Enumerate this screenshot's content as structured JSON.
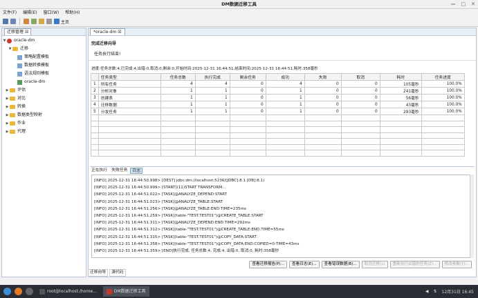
{
  "window": {
    "title": "DM数据迁移工具",
    "controls": [
      "—",
      "□",
      "✕"
    ]
  },
  "menu": [
    "文件(F)",
    "编辑(E)",
    "窗口(W)",
    "帮助(H)"
  ],
  "toolbar": {
    "home_label": "主页"
  },
  "left_panel": {
    "tab_label": "迁移管理 ☒",
    "tree": {
      "root": "oracle-dm",
      "migration": "迁移",
      "children": [
        "策略配置模板",
        "数据转换模板",
        "语法规则模板",
        "oracle-dm"
      ],
      "others": [
        "评估",
        "对比",
        "转换",
        "数据类型映射",
        "作业",
        "代理"
      ]
    }
  },
  "editor": {
    "tab_label": "*oracle-dm ☒",
    "wizard_title": "完成迁移向导",
    "wizard_msg": "任务执行结束!",
    "summary": "进度:任务总数:4,已完成:4,出错:0,取消:0,剩余:0,开始时间:2025-12-31 16:44:51,结束时间:2025-12-31 16:44:51,耗时:358毫秒",
    "table": {
      "headers": [
        "任务类型",
        "任务总数",
        "执行完成",
        "剩余任务",
        "成功",
        "失败",
        "取消",
        "耗时",
        "任务进度"
      ],
      "rows": [
        {
          "idx": "1",
          "type": "所有任务",
          "total": "4",
          "done": "4",
          "remain": "0",
          "success": "4",
          "fail": "0",
          "cancel": "0",
          "time": "105毫秒",
          "progress": "100.0%"
        },
        {
          "idx": "2",
          "type": "分析对象",
          "total": "1",
          "done": "1",
          "remain": "0",
          "success": "1",
          "fail": "0",
          "cancel": "0",
          "time": "241毫秒",
          "progress": "100.0%"
        },
        {
          "idx": "3",
          "type": "创建表",
          "total": "1",
          "done": "1",
          "remain": "0",
          "success": "1",
          "fail": "0",
          "cancel": "0",
          "time": "56毫秒",
          "progress": "100.0%"
        },
        {
          "idx": "4",
          "type": "迁移数据",
          "total": "1",
          "done": "1",
          "remain": "0",
          "success": "1",
          "fail": "0",
          "cancel": "0",
          "time": "43毫秒",
          "progress": "100.0%"
        },
        {
          "idx": "5",
          "type": "分发任务",
          "total": "1",
          "done": "1",
          "remain": "0",
          "success": "1",
          "fail": "0",
          "cancel": "0",
          "time": "293毫秒",
          "progress": "100.0%"
        }
      ]
    }
  },
  "log": {
    "tabs": [
      "正在执行",
      "失败任务",
      "日志"
    ],
    "lines": [
      "[INFO] 2025-12-31 16:44:50.998> [DEST] jdbc:dm://localhost:5236/[JDBC]:8.1 [DB]:8.1)",
      "[INFO] 2025-12-31 16:44:50.999> [START](11)START TRANSFORM...",
      "[INFO] 2025-12-31 16:44:51.022> [TASK]@ANALYZE_DEPEND:START",
      "[INFO] 2025-12-31 16:44:51.023> [TASK]@ANALYZE_TABLE:START",
      "[INFO] 2025-12-31 16:44:51.256> [TASK]@ANALYZE_TABLE:END:TIME=235ms",
      "[INFO] 2025-12-31 16:44:51.259> [TASK](table-\"TEST.TEST01\")@CREATE_TABLE:START",
      "[INFO] 2025-12-31 16:44:51.311> [TASK]@ANALYZE_DEPEND:END:TIME=292ms",
      "[INFO] 2025-12-31 16:44:51.312> [TASK](table-\"TEST.TEST01\")@CREATE_TABLE:END:TIME=55ms",
      "[INFO] 2025-12-31 16:44:51.315> [TASK](table-\"TEST.TEST01\")@COPY_DATA:START",
      "[INFO] 2025-12-31 16:44:51.358> [TASK](table-\"TEST.TEST01\")@COPY_DATA:END:COPIED=0:TIME=43ms",
      "[INFO] 2025-12-31 16:44:51.359> [END]执行完成. 任务总数:4, 完成:4, 出错:0, 取消:0, 耗时:358毫秒"
    ]
  },
  "buttons": [
    "查看迁移报告(P)...",
    "查看日志(E)...",
    "查看错误数据(B)...",
    "取消迁移(L)",
    "重新执行出错的任务(Z)...",
    "修改参数(Y)..."
  ],
  "bottom_tabs": [
    "迁移向导",
    "源代码"
  ],
  "taskbar": {
    "task1": "root@localhost:/home...",
    "task2": "DM数据迁移工具",
    "clock": "12月31日 16:45"
  },
  "colors": {
    "accent": "#cfe0f4",
    "folder": "#e8b93a",
    "taskbar": "#2a2d33"
  }
}
